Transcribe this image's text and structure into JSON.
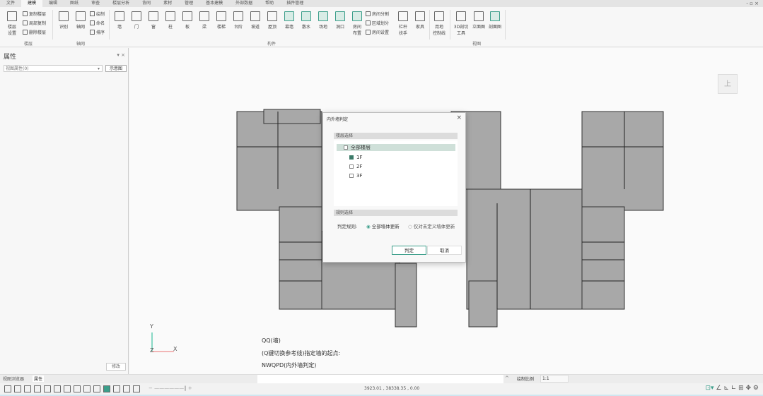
{
  "menu_tabs": [
    "文件",
    "建模",
    "编辑",
    "图纸",
    "审查",
    "楼层分析",
    "协同",
    "素材",
    "管理",
    "基本建模",
    "外部数据",
    "帮助",
    "插件管理"
  ],
  "active_tab": "建模",
  "window_controls": "- ▫ ×",
  "ribbon": {
    "floor": {
      "settings": "楼层\n设置",
      "copy": "复制楼层",
      "partial_copy": "局部复制",
      "delete": "删除楼层",
      "group": "楼层"
    },
    "axis": {
      "recognize": "识别",
      "axis_grid": "轴网",
      "draw": "绘制",
      "name": "命名",
      "order": "排序",
      "group": "轴网"
    },
    "components": [
      "墙",
      "门",
      "窗",
      "柱",
      "板",
      "梁",
      "楼梯",
      "台阶",
      "坡道",
      "屋顶",
      "幕墙",
      "散水",
      "场地",
      "洞口",
      "房间\n布置"
    ],
    "room_small": [
      "房间分割",
      "区域划分",
      "房间设置"
    ],
    "components2": [
      "栏杆\n扶手",
      "家具",
      "用地\n控制线"
    ],
    "component_group": "构件",
    "view": [
      "3D剖切\n工具",
      "立面图",
      "剖面图"
    ],
    "view_group": "视图"
  },
  "left_panel": {
    "title": "属性",
    "dropdown": "视图属性(0)",
    "diagram_btn": "示意图",
    "modify_btn": "修改",
    "tabs": [
      "视图浏览器",
      "属性"
    ]
  },
  "viewcube": "上",
  "axes": {
    "y": "Y",
    "x": "X",
    "z": "Z"
  },
  "command_lines": [
    "QQ(墙)",
    "(Q键切换参考线)指定墙的起点:",
    "NWQPD(内外墙判定)"
  ],
  "dialog": {
    "title": "内外墙判定",
    "floor_section": "楼层选择",
    "all_floors": "全部楼层",
    "floors": [
      {
        "label": "1F",
        "checked": true
      },
      {
        "label": "2F",
        "checked": false
      },
      {
        "label": "3F",
        "checked": false
      }
    ],
    "rule_section": "规则选择",
    "rule_label": "判定规则:",
    "rules": [
      {
        "label": "全部墙体更新",
        "selected": true
      },
      {
        "label": "仅对未定义墙体更新",
        "selected": false
      }
    ],
    "ok": "判定",
    "cancel": "取消"
  },
  "status": {
    "coords": "3923.01 , 38338.35 , 0.00",
    "scale_label": "绘制比例",
    "scale_value": "1:1"
  },
  "accent": "#3b9e8a"
}
